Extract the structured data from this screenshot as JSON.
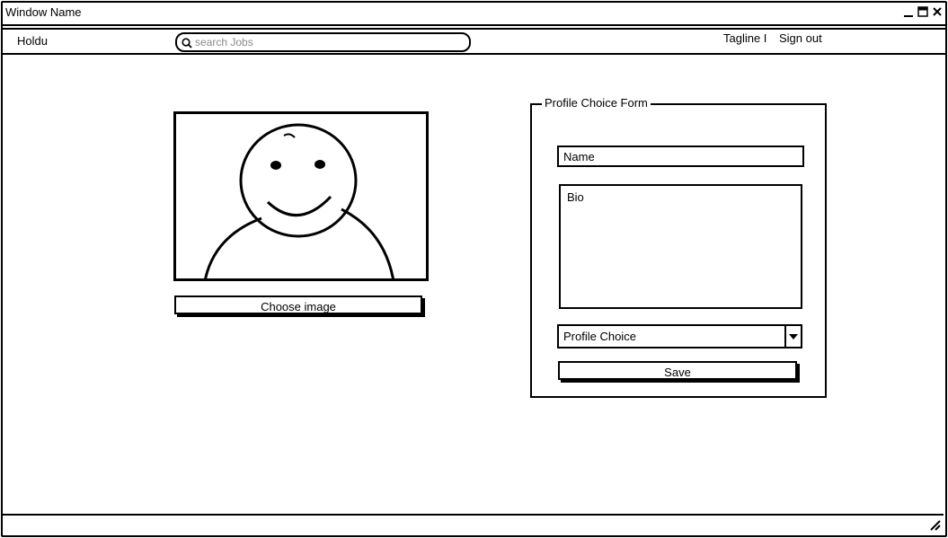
{
  "window": {
    "title": "Window Name"
  },
  "navbar": {
    "brand": "Holdu",
    "search_placeholder": "search Jobs",
    "tagline": "Tagline I",
    "signout": "Sign out"
  },
  "profile_image": {
    "choose_label": "Choose image"
  },
  "form": {
    "legend": "Profile Choice Form",
    "name_value": "Name",
    "bio_value": "Bio",
    "select_value": "Profile Choice",
    "save_label": "Save"
  },
  "icons": {
    "search": "search-icon",
    "minimize": "minimize-icon",
    "maximize": "maximize-icon",
    "close": "close-icon",
    "dropdown": "chevron-down-icon",
    "resize": "resize-grip-icon"
  }
}
